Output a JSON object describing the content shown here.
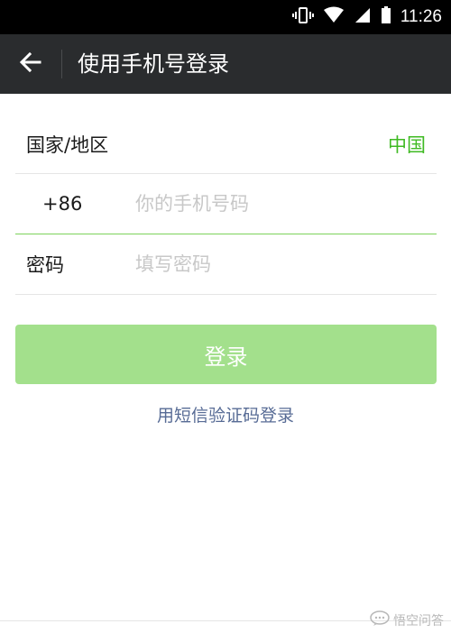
{
  "status_bar": {
    "time": "11:26",
    "icons": [
      "vibrate-icon",
      "wifi-icon",
      "signal-icon",
      "battery-icon"
    ]
  },
  "app_bar": {
    "back_icon": "back-arrow-icon",
    "title": "使用手机号登录"
  },
  "form": {
    "country_label": "国家/地区",
    "country_value": "中国",
    "country_code": "+86",
    "phone_value": "",
    "phone_placeholder": "你的手机号码",
    "password_label": "密码",
    "password_value": "",
    "password_placeholder": "填写密码"
  },
  "login_button": "登录",
  "sms_login_link": "用短信验证码登录",
  "watermark": {
    "icon": "chat-bubble-icon",
    "text": "悟空问答"
  },
  "colors": {
    "status_bar": "#000000",
    "app_bar": "#2a2c2e",
    "accent_green": "#3fba23",
    "button_disabled": "#a3e08c",
    "link_blue": "#576b95",
    "focus_line": "#7dd35b"
  }
}
